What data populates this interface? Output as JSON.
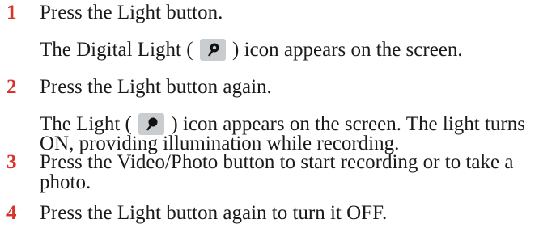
{
  "steps": [
    {
      "number": "1",
      "text": "Press the Light button.",
      "note": {
        "before": "The Digital Light (",
        "icon": "digital-light-icon",
        "after": ") icon appears on the screen."
      }
    },
    {
      "number": "2",
      "text": "Press the Light button again.",
      "note": {
        "before": "The Light (",
        "icon": "light-icon",
        "after_line1": ") icon appears on the screen. The light turns",
        "line2": "ON, providing illumination while recording."
      }
    },
    {
      "number": "3",
      "text_line1": "Press the Video/Photo button to start recording or to take a",
      "text_line2": "photo."
    },
    {
      "number": "4",
      "text": "Press the Light button again to turn it OFF."
    }
  ],
  "colors": {
    "step_number": "#d9342b",
    "icon_background": "#c9cdd0"
  }
}
